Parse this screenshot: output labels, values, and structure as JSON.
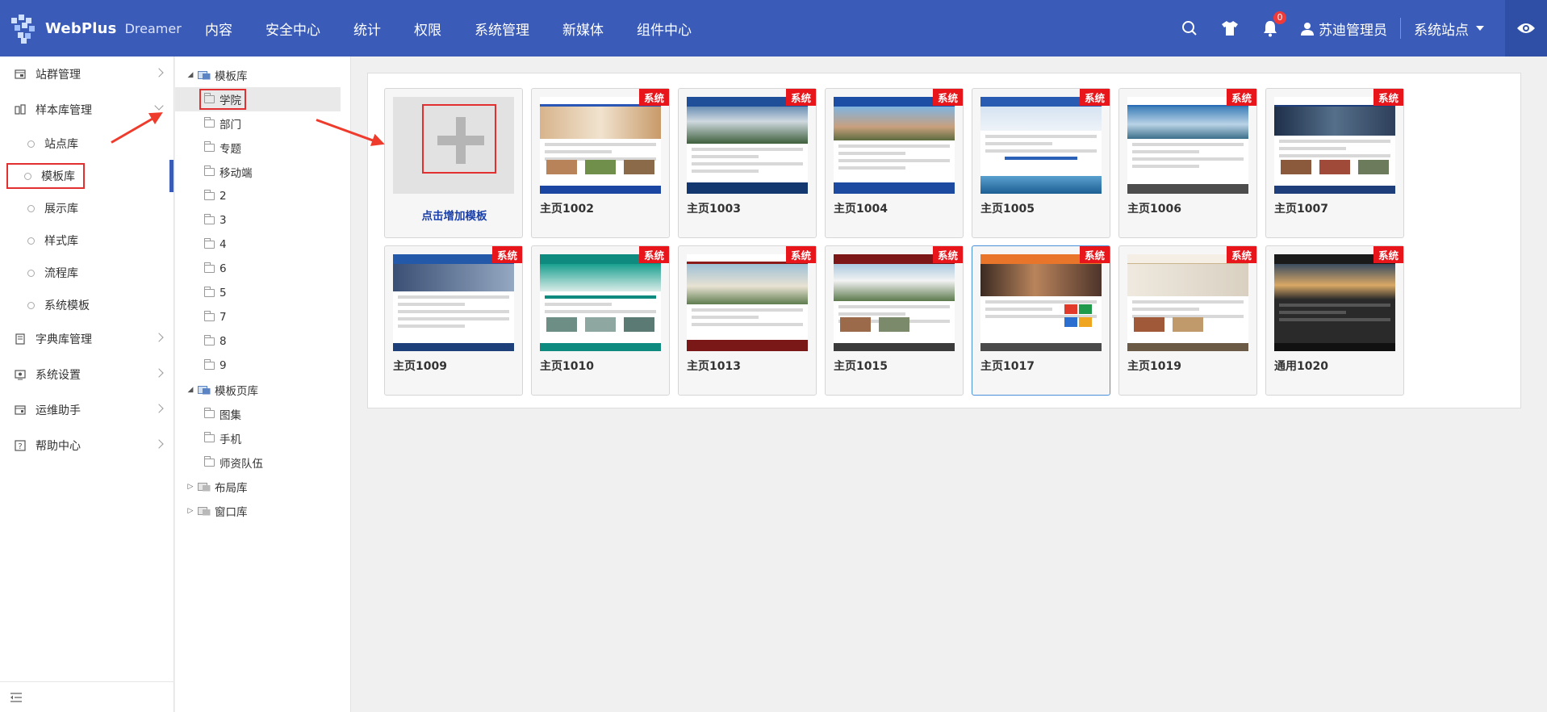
{
  "brand": {
    "name": "WebPlus",
    "sub": "Dreamer"
  },
  "nav": [
    "内容",
    "安全中心",
    "统计",
    "权限",
    "系统管理",
    "新媒体",
    "组件中心"
  ],
  "topRight": {
    "notifications": "0",
    "user": "苏迪管理员",
    "site": "系统站点"
  },
  "sidebar": {
    "groups": [
      {
        "label": "站群管理"
      },
      {
        "label": "样本库管理"
      },
      {
        "label": "字典库管理"
      },
      {
        "label": "系统设置"
      },
      {
        "label": "运维助手"
      },
      {
        "label": "帮助中心"
      }
    ],
    "subs": [
      "站点库",
      "模板库",
      "展示库",
      "样式库",
      "流程库",
      "系统模板"
    ]
  },
  "tree": {
    "templateLib": "模板库",
    "templateChildren": [
      "学院",
      "部门",
      "专题",
      "移动端",
      "2",
      "3",
      "4",
      "6",
      "5",
      "7",
      "8",
      "9"
    ],
    "pageLib": "模板页库",
    "pageChildren": [
      "图集",
      "手机",
      "师资队伍"
    ],
    "layoutLib": "布局库",
    "windowLib": "窗口库"
  },
  "addCard": {
    "label": "点击增加模板"
  },
  "badgeText": "系统",
  "templates": [
    {
      "name": "主页1002"
    },
    {
      "name": "主页1003"
    },
    {
      "name": "主页1004"
    },
    {
      "name": "主页1005"
    },
    {
      "name": "主页1006"
    },
    {
      "name": "主页1007"
    },
    {
      "name": "主页1009"
    },
    {
      "name": "主页1010"
    },
    {
      "name": "主页1013"
    },
    {
      "name": "主页1015"
    },
    {
      "name": "主页1017"
    },
    {
      "name": "主页1019"
    },
    {
      "name": "通用1020"
    }
  ],
  "colors": {
    "topbar": "#3a5bb8",
    "accent": "#e23030",
    "badge": "#e8161b",
    "addLabel": "#1a3fa8"
  }
}
